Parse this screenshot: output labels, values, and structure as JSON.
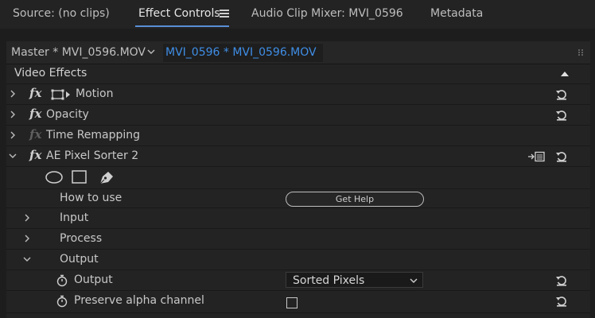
{
  "tabs": [
    {
      "label": "Source: (no clips)"
    },
    {
      "label": "Effect Controls"
    },
    {
      "label": "Audio Clip Mixer: MVI_0596"
    },
    {
      "label": "Metadata"
    }
  ],
  "clip_bar": {
    "master": "Master * MVI_0596.MOV",
    "active": "MVI_0596 * MVI_0596.MOV"
  },
  "section_header": "Video Effects",
  "effects": {
    "motion": "Motion",
    "opacity": "Opacity",
    "time_remapping": "Time Remapping",
    "pixel_sorter": "AE Pixel Sorter 2"
  },
  "fx_symbol": "fx",
  "params": {
    "how_to_use": "How to use",
    "get_help": "Get Help",
    "input": "Input",
    "process": "Process",
    "output_group": "Output",
    "output_param": "Output",
    "output_value": "Sorted Pixels",
    "preserve_alpha": "Preserve alpha channel",
    "preserve_alpha_checked": false
  },
  "colors": {
    "accent_blue": "#3f8ee6",
    "panel_bg": "#232323",
    "text": "#c8c8c8"
  }
}
